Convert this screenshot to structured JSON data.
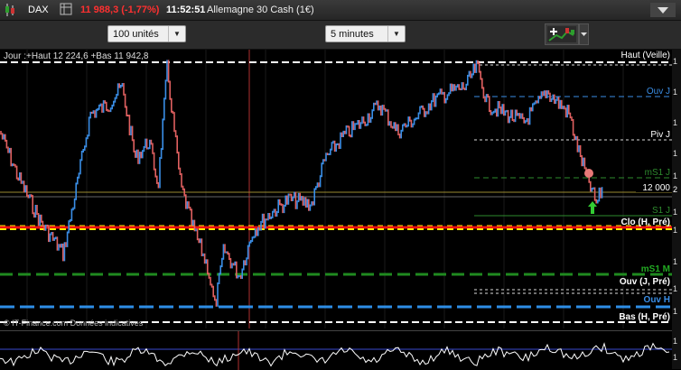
{
  "titlebar": {
    "symbol": "DAX",
    "price_change": "11 988,3 (-1,77%)",
    "time": "11:52:51",
    "instrument": "Allemagne 30 Cash (1€)"
  },
  "toolbar": {
    "quantity_select": "100 unités",
    "period_select": "5 minutes"
  },
  "chart": {
    "info_line": "Jour :+Haut 12 224,6 +Bas 11 942,8",
    "watermark": "© IT-Finance.com Données indicatives",
    "price_tag": "12 000",
    "levels": [
      {
        "label": "Haut (Veille)",
        "color": "#ffffff"
      },
      {
        "label": "Ouv J",
        "color": "#3a8ee6"
      },
      {
        "label": "Piv J",
        "color": "#ffffff"
      },
      {
        "label": "mS1 J",
        "color": "#2e8b2e"
      },
      {
        "label": "S1 J",
        "color": "#2e8b2e"
      },
      {
        "label": "Clo (H, Pré)",
        "color": "#ffffff"
      },
      {
        "label": "mS1 M",
        "color": "#22aa22"
      },
      {
        "label": "Ouv (J, Pré)",
        "color": "#ffffff"
      },
      {
        "label": "Ouv H",
        "color": "#3a8ee6"
      },
      {
        "label": "Bas (H, Pré)",
        "color": "#ffffff"
      }
    ],
    "right_scale_marks": [
      "1",
      "1",
      "1",
      "1",
      "1",
      "2",
      "1",
      "1",
      "1",
      "1",
      "1",
      "1",
      "1"
    ]
  },
  "colors": {
    "up": "#3a8ee6",
    "down": "#e06060",
    "yellow_line": "#ffee00",
    "red_line": "#ee1111",
    "green_line": "#1f8a1f"
  }
}
